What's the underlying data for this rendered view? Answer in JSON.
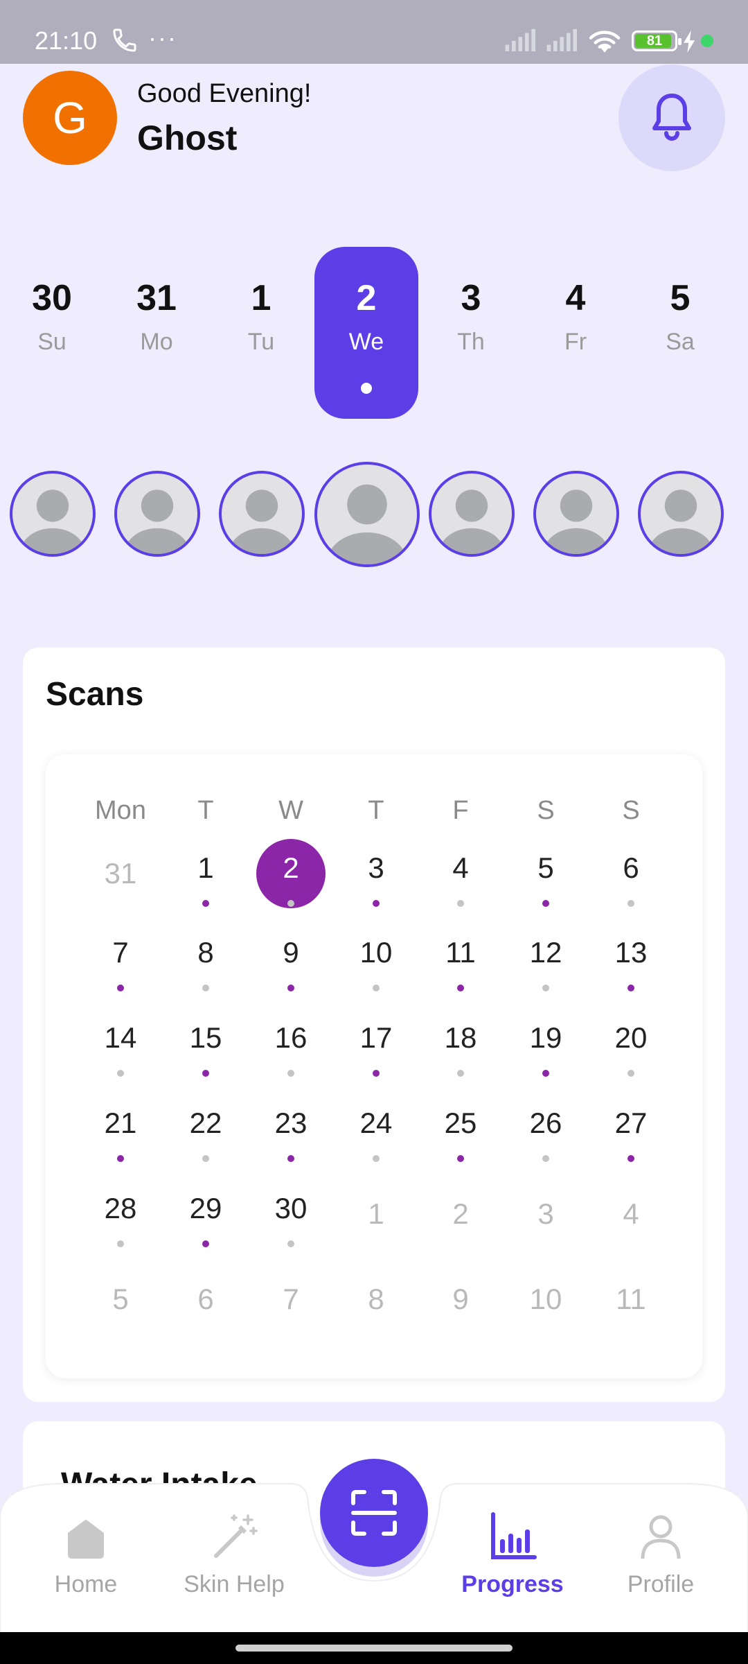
{
  "status_bar": {
    "time": "21:10",
    "more_glyph": "···",
    "battery_level": "81",
    "icons": [
      "phone-icon",
      "signal-icon",
      "wifi-icon",
      "battery-icon",
      "charging-icon"
    ]
  },
  "header": {
    "avatar_initial": "G",
    "greeting": "Good Evening!",
    "username": "Ghost",
    "notification_icon": "bell-icon"
  },
  "week_strip": {
    "days": [
      {
        "num": "30",
        "name": "Su",
        "selected": false
      },
      {
        "num": "31",
        "name": "Mo",
        "selected": false
      },
      {
        "num": "1",
        "name": "Tu",
        "selected": false
      },
      {
        "num": "2",
        "name": "We",
        "selected": true
      },
      {
        "num": "3",
        "name": "Th",
        "selected": false
      },
      {
        "num": "4",
        "name": "Fr",
        "selected": false
      },
      {
        "num": "5",
        "name": "Sa",
        "selected": false
      }
    ]
  },
  "scans": {
    "title": "Scans",
    "weekday_headers": [
      "Mon",
      "T",
      "W",
      "T",
      "F",
      "S",
      "S"
    ],
    "weeks": [
      [
        {
          "n": "31",
          "cur": false,
          "dot": ""
        },
        {
          "n": "1",
          "cur": true,
          "dot": "p"
        },
        {
          "n": "2",
          "cur": true,
          "dot": "g",
          "today": true
        },
        {
          "n": "3",
          "cur": true,
          "dot": "p"
        },
        {
          "n": "4",
          "cur": true,
          "dot": "g"
        },
        {
          "n": "5",
          "cur": true,
          "dot": "p"
        },
        {
          "n": "6",
          "cur": true,
          "dot": "g"
        }
      ],
      [
        {
          "n": "7",
          "cur": true,
          "dot": "p"
        },
        {
          "n": "8",
          "cur": true,
          "dot": "g"
        },
        {
          "n": "9",
          "cur": true,
          "dot": "p"
        },
        {
          "n": "10",
          "cur": true,
          "dot": "g"
        },
        {
          "n": "11",
          "cur": true,
          "dot": "p"
        },
        {
          "n": "12",
          "cur": true,
          "dot": "g"
        },
        {
          "n": "13",
          "cur": true,
          "dot": "p"
        }
      ],
      [
        {
          "n": "14",
          "cur": true,
          "dot": "g"
        },
        {
          "n": "15",
          "cur": true,
          "dot": "p"
        },
        {
          "n": "16",
          "cur": true,
          "dot": "g"
        },
        {
          "n": "17",
          "cur": true,
          "dot": "p"
        },
        {
          "n": "18",
          "cur": true,
          "dot": "g"
        },
        {
          "n": "19",
          "cur": true,
          "dot": "p"
        },
        {
          "n": "20",
          "cur": true,
          "dot": "g"
        }
      ],
      [
        {
          "n": "21",
          "cur": true,
          "dot": "p"
        },
        {
          "n": "22",
          "cur": true,
          "dot": "g"
        },
        {
          "n": "23",
          "cur": true,
          "dot": "p"
        },
        {
          "n": "24",
          "cur": true,
          "dot": "g"
        },
        {
          "n": "25",
          "cur": true,
          "dot": "p"
        },
        {
          "n": "26",
          "cur": true,
          "dot": "g"
        },
        {
          "n": "27",
          "cur": true,
          "dot": "p"
        }
      ],
      [
        {
          "n": "28",
          "cur": true,
          "dot": "g"
        },
        {
          "n": "29",
          "cur": true,
          "dot": "p"
        },
        {
          "n": "30",
          "cur": true,
          "dot": "g"
        },
        {
          "n": "1",
          "cur": false,
          "dot": ""
        },
        {
          "n": "2",
          "cur": false,
          "dot": ""
        },
        {
          "n": "3",
          "cur": false,
          "dot": ""
        },
        {
          "n": "4",
          "cur": false,
          "dot": ""
        }
      ],
      [
        {
          "n": "5",
          "cur": false,
          "dot": ""
        },
        {
          "n": "6",
          "cur": false,
          "dot": ""
        },
        {
          "n": "7",
          "cur": false,
          "dot": ""
        },
        {
          "n": "8",
          "cur": false,
          "dot": ""
        },
        {
          "n": "9",
          "cur": false,
          "dot": ""
        },
        {
          "n": "10",
          "cur": false,
          "dot": ""
        },
        {
          "n": "11",
          "cur": false,
          "dot": ""
        }
      ]
    ]
  },
  "water_card": {
    "title": "Water Intake"
  },
  "bottom_nav": {
    "items": [
      {
        "label": "Home",
        "icon": "home-icon",
        "active": false
      },
      {
        "label": "Skin Help",
        "icon": "magic-wand-icon",
        "active": false
      },
      {
        "label": "Progress",
        "icon": "bar-chart-icon",
        "active": true
      },
      {
        "label": "Profile",
        "icon": "profile-icon",
        "active": false
      }
    ],
    "center_button_icon": "scan-icon"
  },
  "colors": {
    "accent": "#5b3ee6",
    "scan_dot": "#8b26a8",
    "background": "#efedfd",
    "avatar": "#f07100"
  }
}
